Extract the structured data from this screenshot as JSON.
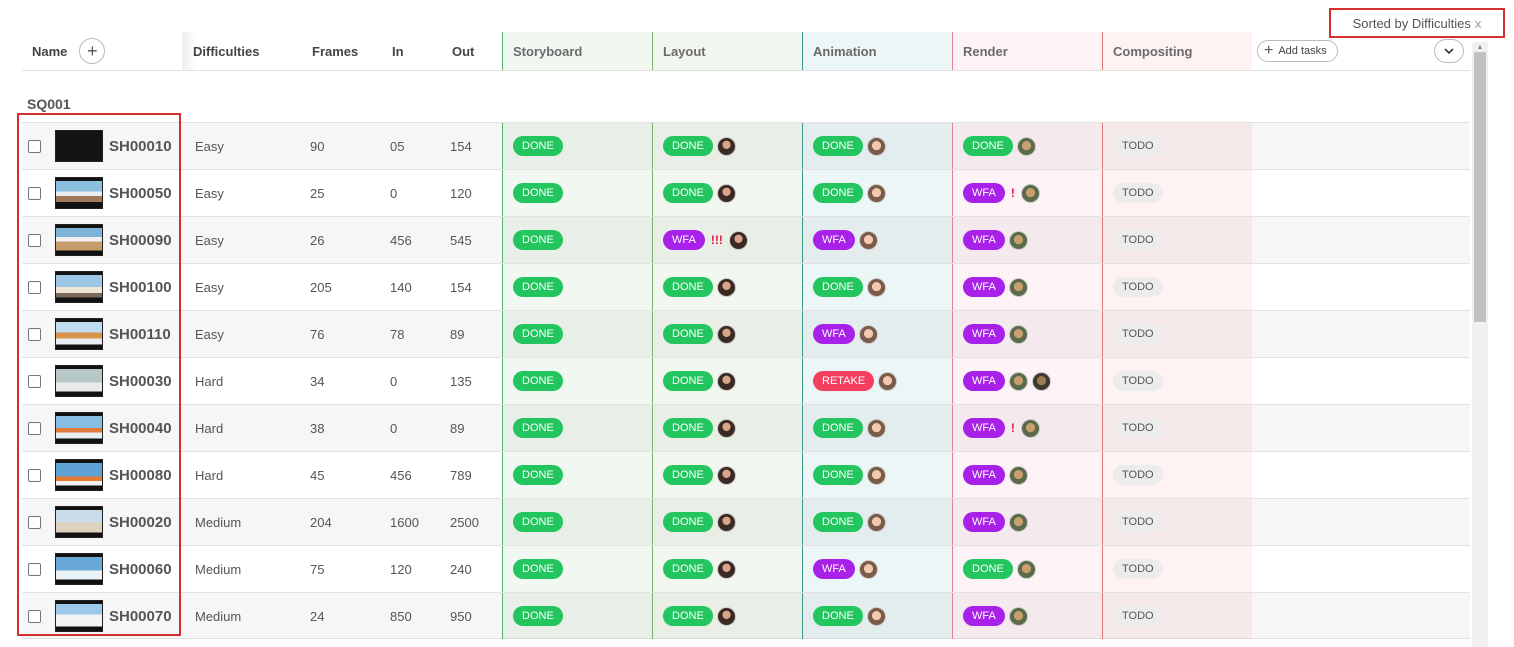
{
  "sort": {
    "label": "Sorted by Difficulties",
    "close": "x"
  },
  "header": {
    "name": "Name",
    "difficulties": "Difficulties",
    "frames": "Frames",
    "in": "In",
    "out": "Out",
    "storyboard": "Storyboard",
    "layout": "Layout",
    "animation": "Animation",
    "render": "Render",
    "compositing": "Compositing",
    "add_tasks": "Add tasks",
    "add_icon": "plus-icon",
    "menu_icon": "chevron-down-icon"
  },
  "sequence": "SQ001",
  "status_colors": {
    "DONE": "#22c55e",
    "WFA": "#a821e8",
    "RETAKE": "#f43f5e",
    "TODO": "#ececec"
  },
  "rows": [
    {
      "name": "SH00010",
      "difficulty": "Easy",
      "frames": "90",
      "in": "05",
      "out": "154",
      "storyboard": "DONE",
      "layout": "DONE",
      "animation": "DONE",
      "render": "DONE",
      "render_alert": "",
      "layout_alert": "",
      "compositing": "TODO"
    },
    {
      "name": "SH00050",
      "difficulty": "Easy",
      "frames": "25",
      "in": "0",
      "out": "120",
      "storyboard": "DONE",
      "layout": "DONE",
      "animation": "DONE",
      "render": "WFA",
      "render_alert": "!",
      "layout_alert": "",
      "compositing": "TODO"
    },
    {
      "name": "SH00090",
      "difficulty": "Easy",
      "frames": "26",
      "in": "456",
      "out": "545",
      "storyboard": "DONE",
      "layout": "WFA",
      "animation": "WFA",
      "render": "WFA",
      "render_alert": "",
      "layout_alert": "!!!",
      "compositing": "TODO"
    },
    {
      "name": "SH00100",
      "difficulty": "Easy",
      "frames": "205",
      "in": "140",
      "out": "154",
      "storyboard": "DONE",
      "layout": "DONE",
      "animation": "DONE",
      "render": "WFA",
      "render_alert": "",
      "layout_alert": "",
      "compositing": "TODO"
    },
    {
      "name": "SH00110",
      "difficulty": "Easy",
      "frames": "76",
      "in": "78",
      "out": "89",
      "storyboard": "DONE",
      "layout": "DONE",
      "animation": "WFA",
      "render": "WFA",
      "render_alert": "",
      "layout_alert": "",
      "compositing": "TODO"
    },
    {
      "name": "SH00030",
      "difficulty": "Hard",
      "frames": "34",
      "in": "0",
      "out": "135",
      "storyboard": "DONE",
      "layout": "DONE",
      "animation": "RETAKE",
      "render": "WFA",
      "render_alert": "",
      "layout_alert": "",
      "compositing": "TODO"
    },
    {
      "name": "SH00040",
      "difficulty": "Hard",
      "frames": "38",
      "in": "0",
      "out": "89",
      "storyboard": "DONE",
      "layout": "DONE",
      "animation": "DONE",
      "render": "WFA",
      "render_alert": "!",
      "layout_alert": "",
      "compositing": "TODO"
    },
    {
      "name": "SH00080",
      "difficulty": "Hard",
      "frames": "45",
      "in": "456",
      "out": "789",
      "storyboard": "DONE",
      "layout": "DONE",
      "animation": "DONE",
      "render": "WFA",
      "render_alert": "",
      "layout_alert": "",
      "compositing": "TODO"
    },
    {
      "name": "SH00020",
      "difficulty": "Medium",
      "frames": "204",
      "in": "1600",
      "out": "2500",
      "storyboard": "DONE",
      "layout": "DONE",
      "animation": "DONE",
      "render": "WFA",
      "render_alert": "",
      "layout_alert": "",
      "compositing": "TODO"
    },
    {
      "name": "SH00060",
      "difficulty": "Medium",
      "frames": "75",
      "in": "120",
      "out": "240",
      "storyboard": "DONE",
      "layout": "DONE",
      "animation": "WFA",
      "render": "DONE",
      "render_alert": "",
      "layout_alert": "",
      "compositing": "TODO"
    },
    {
      "name": "SH00070",
      "difficulty": "Medium",
      "frames": "24",
      "in": "850",
      "out": "950",
      "storyboard": "DONE",
      "layout": "DONE",
      "animation": "DONE",
      "render": "WFA",
      "render_alert": "",
      "layout_alert": "",
      "compositing": "TODO"
    }
  ]
}
